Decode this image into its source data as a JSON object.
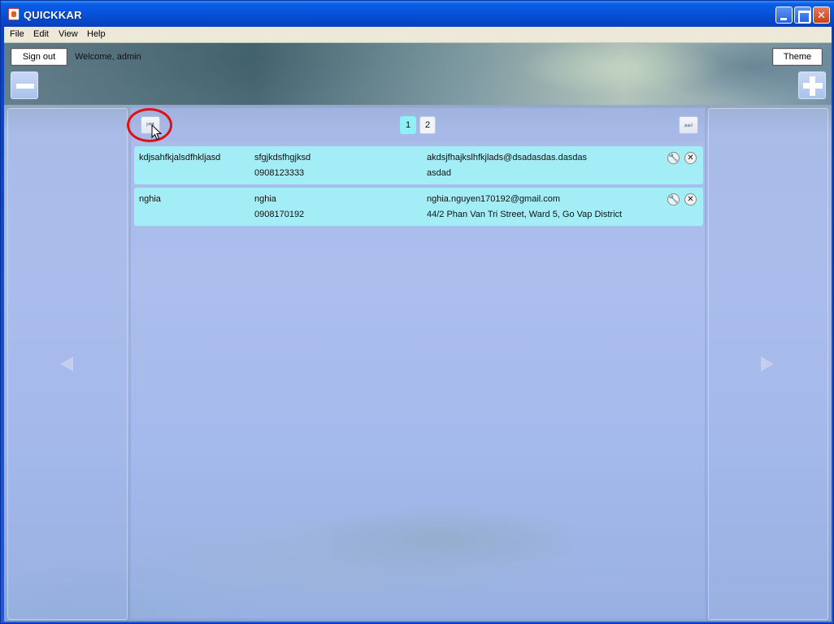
{
  "window": {
    "title": "QUICKKAR"
  },
  "menu": {
    "items": [
      "File",
      "Edit",
      "View",
      "Help"
    ]
  },
  "header": {
    "signout_label": "Sign out",
    "welcome_text": "Welcome, admin",
    "theme_label": "Theme"
  },
  "pager": {
    "first_icon": "⏮",
    "last_icon": "⏭",
    "pages": [
      "1",
      "2"
    ],
    "current_page": "1"
  },
  "records": [
    {
      "name": "kdjsahfkjalsdfhkljasd",
      "username": "sfgjkdsfhgjksd",
      "phone": "0908123333",
      "email": "akdsjfhajkslhfkjlads@dsadasdas.dasdas",
      "address": "asdad"
    },
    {
      "name": "nghia",
      "username": "nghia",
      "phone": "0908170192",
      "email": "nghia.nguyen170192@gmail.com",
      "address": "44/2 Phan Van Tri Street, Ward 5, Go Vap District"
    }
  ],
  "colors": {
    "record_bg": "#a3eef6",
    "active_page": "#8ff0f6",
    "highlight": "#e01010"
  }
}
